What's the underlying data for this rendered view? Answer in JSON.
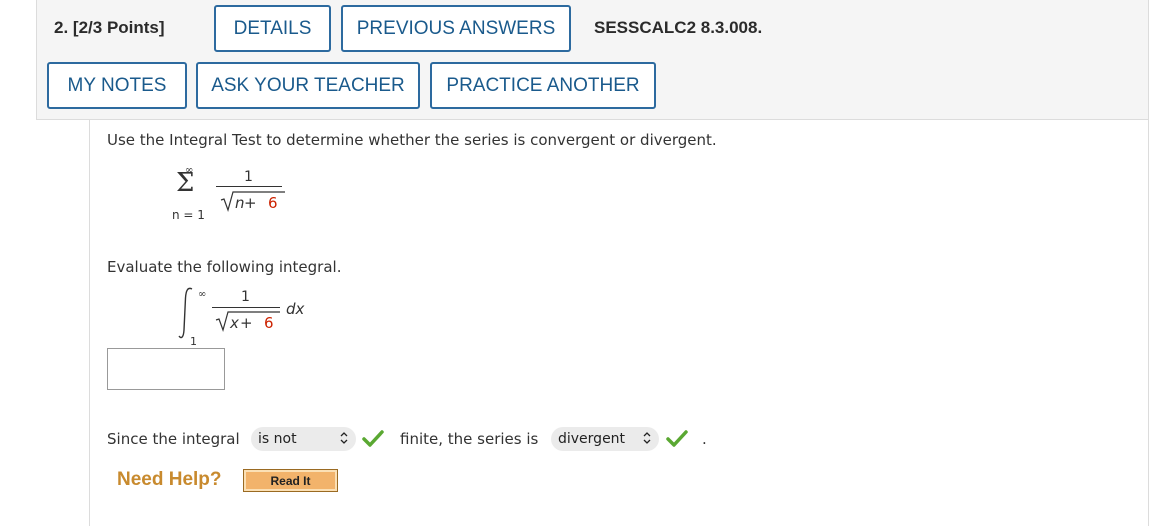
{
  "question": {
    "number": "2.",
    "points": "[2/3 Points]",
    "id": "SESSCALC2 8.3.008."
  },
  "buttons": {
    "details": "DETAILS",
    "previous_answers": "PREVIOUS ANSWERS",
    "my_notes": "MY NOTES",
    "ask_teacher": "ASK YOUR TEACHER",
    "practice_another": "PRACTICE ANOTHER"
  },
  "prompt": "Use the Integral Test to determine whether the series is convergent or divergent.",
  "series": {
    "upper": "∞",
    "lower": "n = 1",
    "numerator": "1",
    "radicand_var": "n",
    "radicand_op": " + ",
    "radicand_const": "6"
  },
  "evaluate_text": "Evaluate the following integral.",
  "integral": {
    "upper": "∞",
    "lower": "1",
    "numerator": "1",
    "radicand_var": "x",
    "radicand_op": " + ",
    "radicand_const": "6",
    "differential": "dx"
  },
  "answer_input": {
    "value": ""
  },
  "conclusion": {
    "prefix": "Since the integral",
    "select1_value": "is not",
    "middle": "finite, the series is",
    "select2_value": "divergent",
    "suffix": "."
  },
  "help": {
    "label": "Need Help?",
    "read_it": "Read It"
  },
  "colors": {
    "button_border": "#2d6a9f",
    "button_text": "#1a5a8c",
    "red_constant": "#cc2200",
    "check_green": "#5aa832",
    "need_help": "#c88a2e",
    "read_it_bg": "#f2b36b"
  },
  "icons": {
    "select_chevron": "chevron-updown-icon",
    "correct": "checkmark-icon"
  }
}
